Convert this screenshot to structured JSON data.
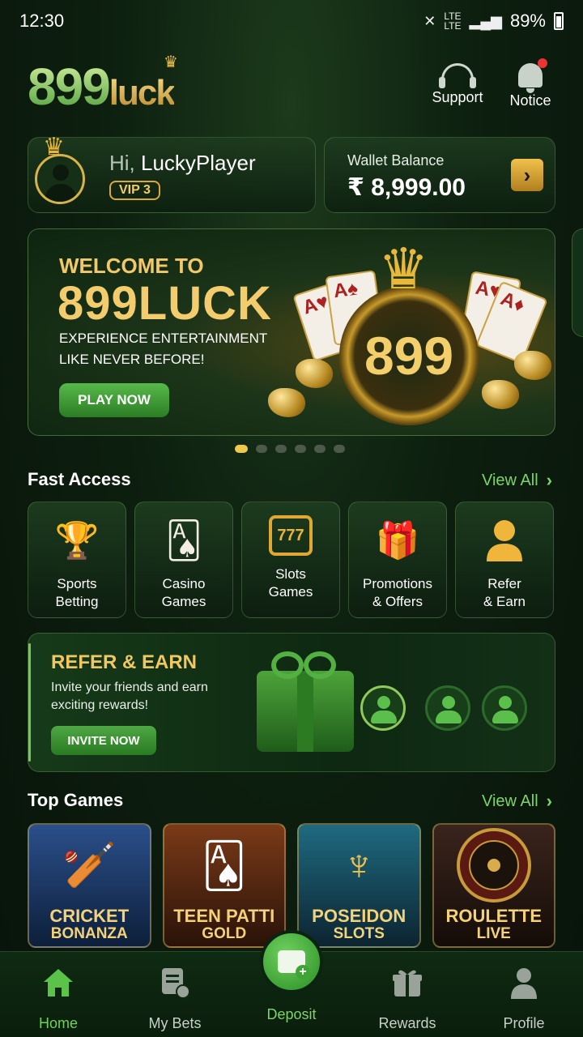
{
  "status_bar": {
    "time": "12:30",
    "battery": "89%"
  },
  "header": {
    "logo_num": "899",
    "logo_word": "luck",
    "support_label": "Support",
    "notice_label": "Notice"
  },
  "profile": {
    "greeting": "Hi,",
    "username": "LuckyPlayer",
    "vip": "VIP 3"
  },
  "wallet": {
    "label": "Wallet Balance",
    "value": "₹ 8,999.00"
  },
  "banner": {
    "welcome": "WELCOME TO",
    "brand": "899LUCK",
    "subtitle": "EXPERIENCE ENTERTAINMENT LIKE NEVER BEFORE!",
    "cta": "PLAY NOW",
    "coin_text": "899",
    "slides_total": 6,
    "active_slide": 1
  },
  "fast_access": {
    "title": "Fast Access",
    "view_all": "View All",
    "items": [
      {
        "label": "Sports\nBetting",
        "icon": "trophy-icon"
      },
      {
        "label": "Casino\nGames",
        "icon": "playing-cards-icon"
      },
      {
        "label": "Slots\nGames",
        "icon": "slot-machine-icon"
      },
      {
        "label": "Promotions\n& Offers",
        "icon": "gift-icon"
      },
      {
        "label": "Refer\n& Earn",
        "icon": "user-icon"
      }
    ]
  },
  "refer": {
    "title": "REFER & EARN",
    "subtitle": "Invite your friends and earn exciting rewards!",
    "cta": "INVITE NOW"
  },
  "top_games": {
    "title": "Top Games",
    "view_all": "View All",
    "items": [
      {
        "line1": "CRICKET",
        "line2": "BONANZA",
        "bg": "#1d3a6a"
      },
      {
        "line1": "TEEN PATTI",
        "line2": "GOLD",
        "bg": "#5a2a14"
      },
      {
        "line1": "POSEIDON",
        "line2": "SLOTS",
        "bg": "#1b4a5a"
      },
      {
        "line1": "ROULETTE",
        "line2": "LIVE",
        "bg": "#2a1a16"
      }
    ]
  },
  "bottom_nav": {
    "home": "Home",
    "my_bets": "My Bets",
    "deposit": "Deposit",
    "rewards": "Rewards",
    "profile": "Profile"
  }
}
